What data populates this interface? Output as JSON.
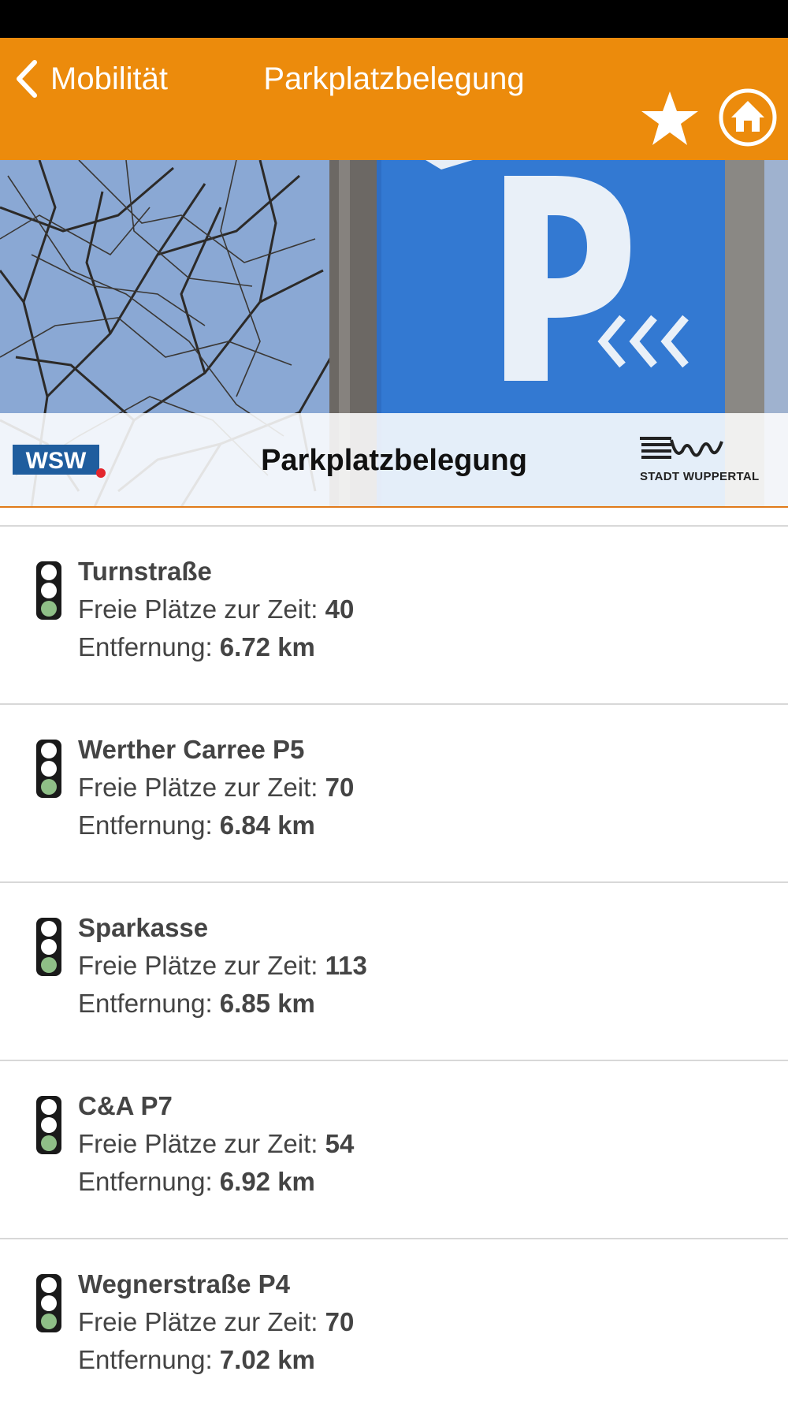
{
  "nav": {
    "back_label": "Mobilität",
    "title": "Parkplatzbelegung",
    "back_icon": "chevron-left-icon",
    "favorite_icon": "star-icon",
    "home_icon": "home-icon"
  },
  "banner": {
    "title": "Parkplatzbelegung",
    "left_logo": "WSW",
    "right_logo_text": "STADT WUPPERTAL"
  },
  "colors": {
    "nav_bg": "#ec8b0c",
    "accent_line": "#e07a1a",
    "light_green": "#8fbf87"
  },
  "list": {
    "free_label": "Freie Plätze zur Zeit: ",
    "distance_label": "Entfernung: ",
    "items": [
      {
        "name": "Turnstraße",
        "free": "40",
        "distance": "6.72 km",
        "status": "green"
      },
      {
        "name": "Werther Carree P5",
        "free": "70",
        "distance": "6.84 km",
        "status": "green"
      },
      {
        "name": "Sparkasse",
        "free": "113",
        "distance": "6.85 km",
        "status": "green"
      },
      {
        "name": "C&A P7",
        "free": "54",
        "distance": "6.92 km",
        "status": "green"
      },
      {
        "name": "Wegnerstraße P4",
        "free": "70",
        "distance": "7.02 km",
        "status": "green"
      }
    ]
  }
}
